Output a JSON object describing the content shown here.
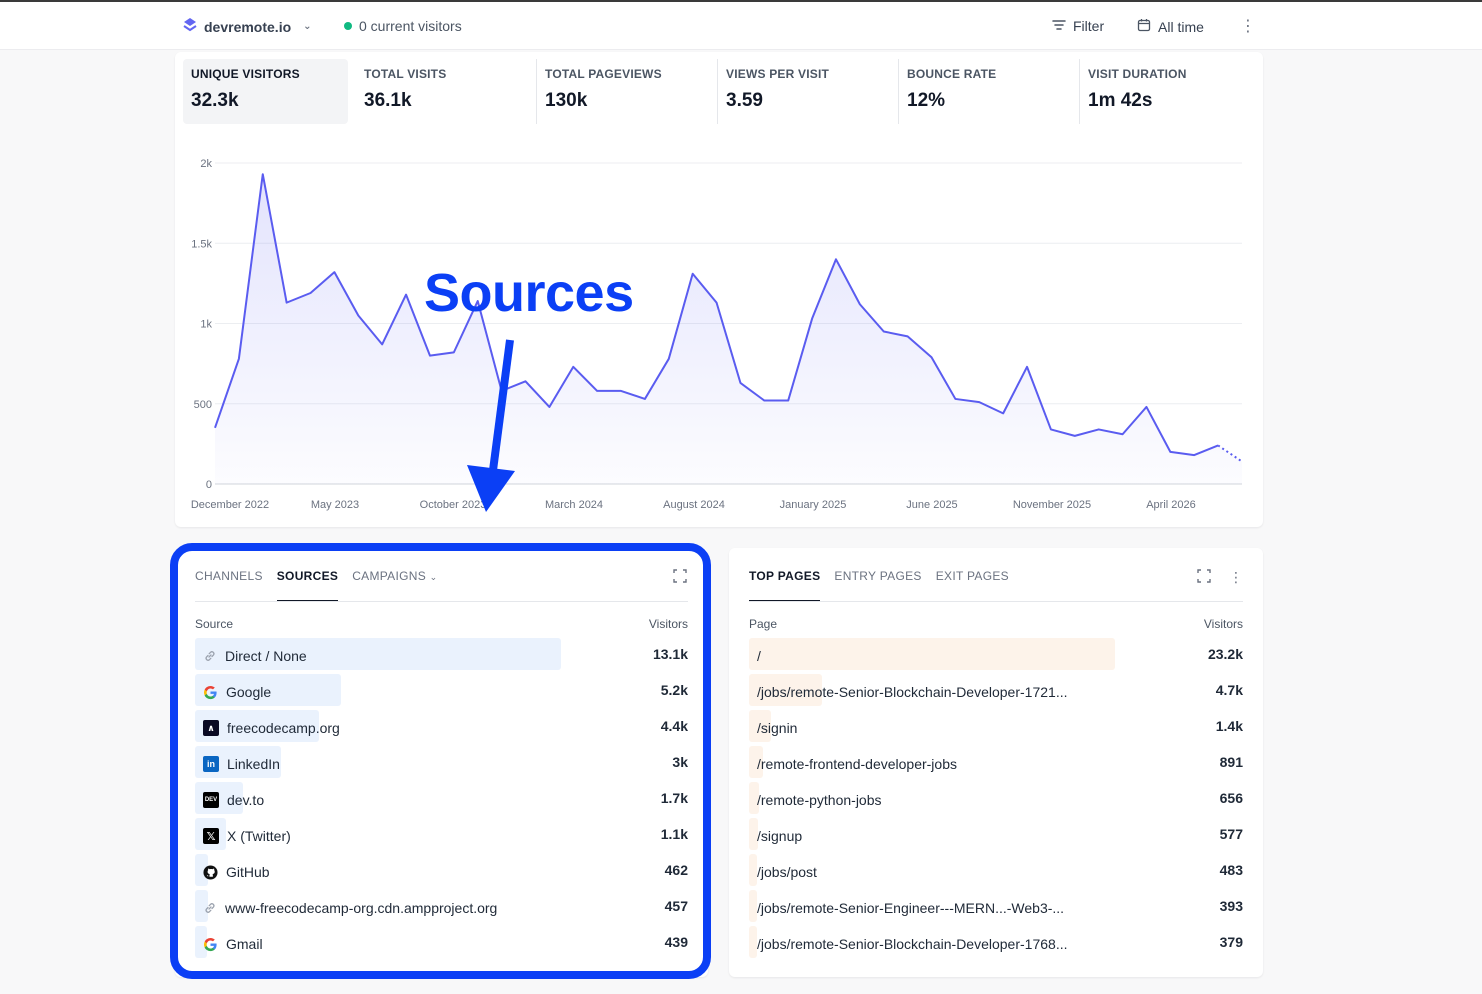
{
  "topbar": {
    "site_name": "devremote.io",
    "current_visitors": "0 current visitors",
    "filter_label": "Filter",
    "period_label": "All time"
  },
  "stats": [
    {
      "label": "UNIQUE VISITORS",
      "value": "32.3k",
      "active": true
    },
    {
      "label": "TOTAL VISITS",
      "value": "36.1k"
    },
    {
      "label": "TOTAL PAGEVIEWS",
      "value": "130k"
    },
    {
      "label": "VIEWS PER VISIT",
      "value": "3.59"
    },
    {
      "label": "BOUNCE RATE",
      "value": "12%"
    },
    {
      "label": "VISIT DURATION",
      "value": "1m 42s"
    }
  ],
  "chart_data": {
    "type": "area",
    "title": "",
    "xlabel": "",
    "ylabel": "",
    "ylim": [
      0,
      2000
    ],
    "y_ticks": [
      "0",
      "500",
      "1k",
      "1.5k",
      "2k"
    ],
    "x_tick_labels": [
      "December 2022",
      "May 2023",
      "October 2023",
      "March 2024",
      "August 2024",
      "January 2025",
      "June 2025",
      "November 2025",
      "April 2026"
    ],
    "grid": true,
    "line_color": "#5a5cf0",
    "values": [
      350,
      780,
      1930,
      1130,
      1190,
      1320,
      1050,
      870,
      1180,
      800,
      820,
      1140,
      580,
      640,
      480,
      730,
      580,
      580,
      530,
      780,
      1310,
      1130,
      630,
      520,
      520,
      1030,
      1400,
      1120,
      950,
      920,
      790,
      530,
      510,
      440,
      730,
      340,
      300,
      340,
      310,
      480,
      200,
      180,
      240,
      140
    ],
    "dotted_from_index": 42
  },
  "annotation": {
    "text": "Sources",
    "color": "#0b3ff5"
  },
  "sources_panel": {
    "tabs": [
      "CHANNELS",
      "SOURCES",
      "CAMPAIGNS"
    ],
    "active_tab": "SOURCES",
    "col_left": "Source",
    "col_right": "Visitors",
    "rows": [
      {
        "name": "Direct / None",
        "value": "13.1k",
        "pct": 1.0,
        "icon": "link-icon"
      },
      {
        "name": "Google",
        "value": "5.2k",
        "pct": 0.4,
        "icon": "google-icon"
      },
      {
        "name": "freecodecamp.org",
        "value": "4.4k",
        "pct": 0.34,
        "icon": "freecodecamp-icon"
      },
      {
        "name": "LinkedIn",
        "value": "3k",
        "pct": 0.235,
        "icon": "linkedin-icon"
      },
      {
        "name": "dev.to",
        "value": "1.7k",
        "pct": 0.13,
        "icon": "devto-icon"
      },
      {
        "name": "X (Twitter)",
        "value": "1.1k",
        "pct": 0.085,
        "icon": "x-icon"
      },
      {
        "name": "GitHub",
        "value": "462",
        "pct": 0.036,
        "icon": "github-icon"
      },
      {
        "name": "www-freecodecamp-org.cdn.ampproject.org",
        "value": "457",
        "pct": 0.035,
        "icon": "link-icon"
      },
      {
        "name": "Gmail",
        "value": "439",
        "pct": 0.034,
        "icon": "google-icon"
      }
    ]
  },
  "pages_panel": {
    "tabs": [
      "TOP PAGES",
      "ENTRY PAGES",
      "EXIT PAGES"
    ],
    "active_tab": "TOP PAGES",
    "col_left": "Page",
    "col_right": "Visitors",
    "rows": [
      {
        "name": "/",
        "value": "23.2k",
        "pct": 1.0
      },
      {
        "name": "/jobs/remote-Senior-Blockchain-Developer-1721...",
        "value": "4.7k",
        "pct": 0.2
      },
      {
        "name": "/signin",
        "value": "1.4k",
        "pct": 0.06
      },
      {
        "name": "/remote-frontend-developer-jobs",
        "value": "891",
        "pct": 0.038
      },
      {
        "name": "/remote-python-jobs",
        "value": "656",
        "pct": 0.028
      },
      {
        "name": "/signup",
        "value": "577",
        "pct": 0.025
      },
      {
        "name": "/jobs/post",
        "value": "483",
        "pct": 0.021
      },
      {
        "name": "/jobs/remote-Senior-Engineer---MERN...-Web3-...",
        "value": "393",
        "pct": 0.017
      },
      {
        "name": "/jobs/remote-Senior-Blockchain-Developer-1768...",
        "value": "379",
        "pct": 0.016
      }
    ]
  }
}
